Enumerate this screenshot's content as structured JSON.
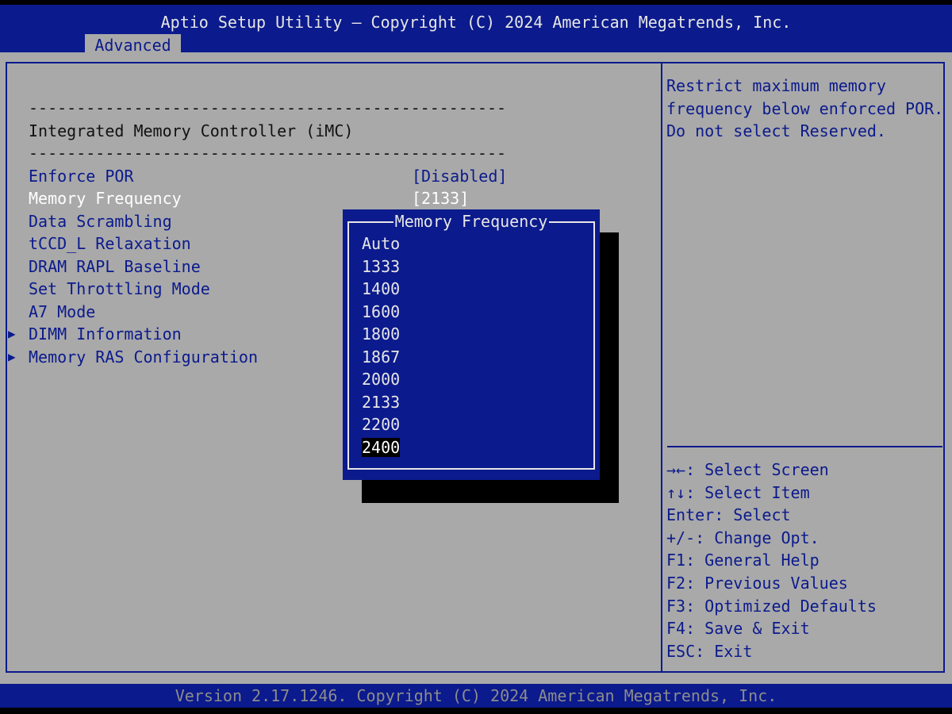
{
  "header": {
    "title": "Aptio Setup Utility – Copyright (C) 2024 American Megatrends, Inc.",
    "tab": "Advanced"
  },
  "main": {
    "divider_top": "--------------------------------------------------",
    "section_title": "Integrated Memory Controller (iMC)",
    "divider_bottom": "--------------------------------------------------",
    "items": [
      {
        "label": "Enforce POR",
        "value": "[Disabled]"
      },
      {
        "label": "Memory Frequency",
        "value": "[2133]"
      },
      {
        "label": "Data Scrambling",
        "value": ""
      },
      {
        "label": "tCCD_L Relaxation",
        "value": ""
      },
      {
        "label": "DRAM RAPL Baseline",
        "value": ""
      },
      {
        "label": "Set Throttling Mode",
        "value": ""
      },
      {
        "label": "A7 Mode",
        "value": ""
      },
      {
        "label": "DIMM Information",
        "value": ""
      },
      {
        "label": "Memory RAS Configuration",
        "value": ""
      }
    ],
    "submenu_arrow": "▶"
  },
  "help": {
    "description": "Restrict maximum memory frequency below enforced POR. Do not select Reserved.",
    "keys": [
      "→←: Select Screen",
      "↑↓: Select Item",
      "Enter: Select",
      "+/-: Change Opt.",
      "F1: General Help",
      "F2: Previous Values",
      "F3: Optimized Defaults",
      "F4: Save & Exit",
      "ESC: Exit"
    ]
  },
  "popup": {
    "title": "Memory Frequency",
    "options": [
      "Auto",
      "1333",
      "1400",
      "1600",
      "1800",
      "1867",
      "2000",
      "2133",
      "2200",
      "2400"
    ],
    "selected": "2400"
  },
  "footer": {
    "text": "Version 2.17.1246. Copyright (C) 2024 American Megatrends, Inc."
  },
  "colors": {
    "background": "#a9a9a9",
    "bar": "#0b1a8c",
    "text_blue": "#0b1a8c",
    "highlight": "#ffffff"
  }
}
